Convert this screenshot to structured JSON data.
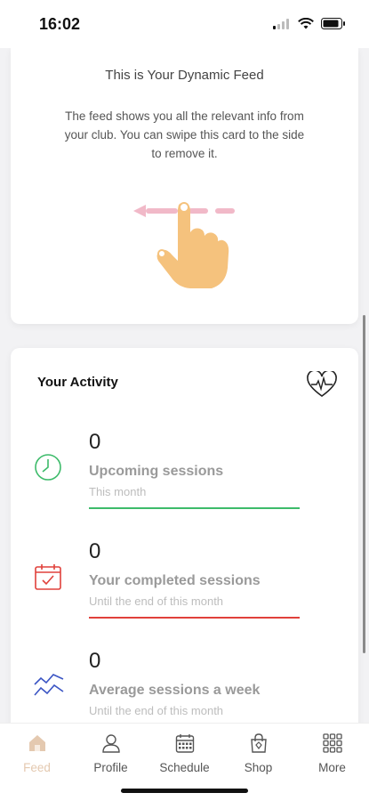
{
  "status": {
    "time": "16:02"
  },
  "intro": {
    "title": "This is Your Dynamic Feed",
    "text": "The feed shows you all the relevant info from your club. You can swipe this card to the side to remove it."
  },
  "activity": {
    "title": "Your Activity",
    "stats": [
      {
        "value": "0",
        "label": "Upcoming sessions",
        "sub": "This month",
        "color": "#3dbb6a",
        "icon": "clock-icon"
      },
      {
        "value": "0",
        "label": "Your completed sessions",
        "sub": "Until the end of this month",
        "color": "#e0413b",
        "icon": "calendar-check-icon"
      },
      {
        "value": "0",
        "label": "Average sessions a week",
        "sub": "Until the end of this month",
        "color": "#3b55c4",
        "icon": "trend-lines-icon"
      }
    ]
  },
  "tabs": [
    {
      "label": "Feed",
      "icon": "home-icon",
      "active": true
    },
    {
      "label": "Profile",
      "icon": "person-icon",
      "active": false
    },
    {
      "label": "Schedule",
      "icon": "calendar-icon",
      "active": false
    },
    {
      "label": "Shop",
      "icon": "shopping-bag-icon",
      "active": false
    },
    {
      "label": "More",
      "icon": "grid-icon",
      "active": false
    }
  ],
  "colors": {
    "accent_feed": "#e4c9b0",
    "hand": "#f5c27d",
    "arrow": "#f1b9c8"
  }
}
